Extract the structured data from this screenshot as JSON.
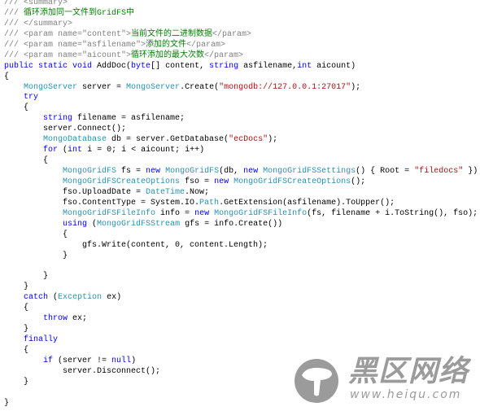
{
  "colors": {
    "keyword": "#0000ff",
    "type": "#2b91af",
    "string": "#a31515",
    "comment": "#808080",
    "comment_text": "#008000"
  },
  "code_lines": [
    [
      [
        "/// ",
        "c"
      ],
      [
        "<summary>",
        "x"
      ]
    ],
    [
      [
        "/// ",
        "c"
      ],
      [
        "循环添加同一文件到GridFS中",
        "g"
      ]
    ],
    [
      [
        "/// ",
        "c"
      ],
      [
        "</summary>",
        "x"
      ]
    ],
    [
      [
        "/// ",
        "c"
      ],
      [
        "<param name=\"content\">",
        "x"
      ],
      [
        "当前文件的二进制数据",
        "g"
      ],
      [
        "</param>",
        "x"
      ]
    ],
    [
      [
        "/// ",
        "c"
      ],
      [
        "<param name=\"asfilename\">",
        "x"
      ],
      [
        "添加的文件",
        "g"
      ],
      [
        "</param>",
        "x"
      ]
    ],
    [
      [
        "/// ",
        "c"
      ],
      [
        "<param name=\"aicount\">",
        "x"
      ],
      [
        "循环添加的最大次数",
        "g"
      ],
      [
        "</param>",
        "x"
      ]
    ],
    [
      [
        "public static void ",
        "k"
      ],
      [
        "AddDoc(",
        "p"
      ],
      [
        "byte",
        "k"
      ],
      [
        "[] content, ",
        "p"
      ],
      [
        "string",
        "k"
      ],
      [
        " asfilename,",
        "p"
      ],
      [
        "int",
        "k"
      ],
      [
        " aicount)",
        "p"
      ]
    ],
    [
      [
        "{",
        "p"
      ]
    ],
    [
      [
        "    ",
        "p"
      ],
      [
        "MongoServer",
        "t"
      ],
      [
        " server = ",
        "p"
      ],
      [
        "MongoServer",
        "t"
      ],
      [
        ".Create(",
        "p"
      ],
      [
        "\"mongodb://127.0.0.1:27017\"",
        "s"
      ],
      [
        ");",
        "p"
      ]
    ],
    [
      [
        "    ",
        "p"
      ],
      [
        "try",
        "k"
      ]
    ],
    [
      [
        "    {",
        "p"
      ]
    ],
    [
      [
        "        ",
        "p"
      ],
      [
        "string",
        "k"
      ],
      [
        " filename = asfilename;",
        "p"
      ]
    ],
    [
      [
        "        server.Connect();",
        "p"
      ]
    ],
    [
      [
        "        ",
        "p"
      ],
      [
        "MongoDatabase",
        "t"
      ],
      [
        " db = server.GetDatabase(",
        "p"
      ],
      [
        "\"ecDocs\"",
        "s"
      ],
      [
        ");",
        "p"
      ]
    ],
    [
      [
        "        ",
        "p"
      ],
      [
        "for",
        "k"
      ],
      [
        " (",
        "p"
      ],
      [
        "int",
        "k"
      ],
      [
        " i = 0; i < aicount; i++)",
        "p"
      ]
    ],
    [
      [
        "        {",
        "p"
      ]
    ],
    [
      [
        "            ",
        "p"
      ],
      [
        "MongoGridFS",
        "t"
      ],
      [
        " fs = ",
        "p"
      ],
      [
        "new",
        "k"
      ],
      [
        " ",
        "p"
      ],
      [
        "MongoGridFS",
        "t"
      ],
      [
        "(db, ",
        "p"
      ],
      [
        "new",
        "k"
      ],
      [
        " ",
        "p"
      ],
      [
        "MongoGridFSSettings",
        "t"
      ],
      [
        "() { Root = ",
        "p"
      ],
      [
        "\"filedocs\"",
        "s"
      ],
      [
        " })",
        "p"
      ]
    ],
    [
      [
        "            ",
        "p"
      ],
      [
        "MongoGridFSCreateOptions",
        "t"
      ],
      [
        " fso = ",
        "p"
      ],
      [
        "new",
        "k"
      ],
      [
        " ",
        "p"
      ],
      [
        "MongoGridFSCreateOptions",
        "t"
      ],
      [
        "();",
        "p"
      ]
    ],
    [
      [
        "            fso.UploadDate = ",
        "p"
      ],
      [
        "DateTime",
        "t"
      ],
      [
        ".Now;",
        "p"
      ]
    ],
    [
      [
        "            fso.ContentType = System.IO.",
        "p"
      ],
      [
        "Path",
        "t"
      ],
      [
        ".GetExtension(asfilename).ToUpper();",
        "p"
      ]
    ],
    [
      [
        "            ",
        "p"
      ],
      [
        "MongoGridFSFileInfo",
        "t"
      ],
      [
        " info = ",
        "p"
      ],
      [
        "new",
        "k"
      ],
      [
        " ",
        "p"
      ],
      [
        "MongoGridFSFileInfo",
        "t"
      ],
      [
        "(fs, filename + i.ToString(), fso);",
        "p"
      ]
    ],
    [
      [
        "            ",
        "p"
      ],
      [
        "using",
        "k"
      ],
      [
        " (",
        "p"
      ],
      [
        "MongoGridFSStream",
        "t"
      ],
      [
        " gfs = info.Create())",
        "p"
      ]
    ],
    [
      [
        "            {",
        "p"
      ]
    ],
    [
      [
        "                gfs.Write(content, 0, content.Length);",
        "p"
      ]
    ],
    [
      [
        "            }",
        "p"
      ]
    ],
    [
      [
        "",
        "p"
      ]
    ],
    [
      [
        "        }",
        "p"
      ]
    ],
    [
      [
        "    }",
        "p"
      ]
    ],
    [
      [
        "    ",
        "p"
      ],
      [
        "catch",
        "k"
      ],
      [
        " (",
        "p"
      ],
      [
        "Exception",
        "t"
      ],
      [
        " ex)",
        "p"
      ]
    ],
    [
      [
        "    {",
        "p"
      ]
    ],
    [
      [
        "        ",
        "p"
      ],
      [
        "throw",
        "k"
      ],
      [
        " ex;",
        "p"
      ]
    ],
    [
      [
        "    }",
        "p"
      ]
    ],
    [
      [
        "    ",
        "p"
      ],
      [
        "finally",
        "k"
      ]
    ],
    [
      [
        "    {",
        "p"
      ]
    ],
    [
      [
        "        ",
        "p"
      ],
      [
        "if",
        "k"
      ],
      [
        " (server != ",
        "p"
      ],
      [
        "null",
        "k"
      ],
      [
        ")",
        "p"
      ]
    ],
    [
      [
        "            server.Disconnect();",
        "p"
      ]
    ],
    [
      [
        "    }",
        "p"
      ]
    ],
    [
      [
        "",
        "p"
      ]
    ],
    [
      [
        "}",
        "p"
      ]
    ]
  ],
  "watermark": {
    "title": "黑区网络",
    "url": "www.heiqu.com",
    "icon": "mushroom-icon"
  }
}
